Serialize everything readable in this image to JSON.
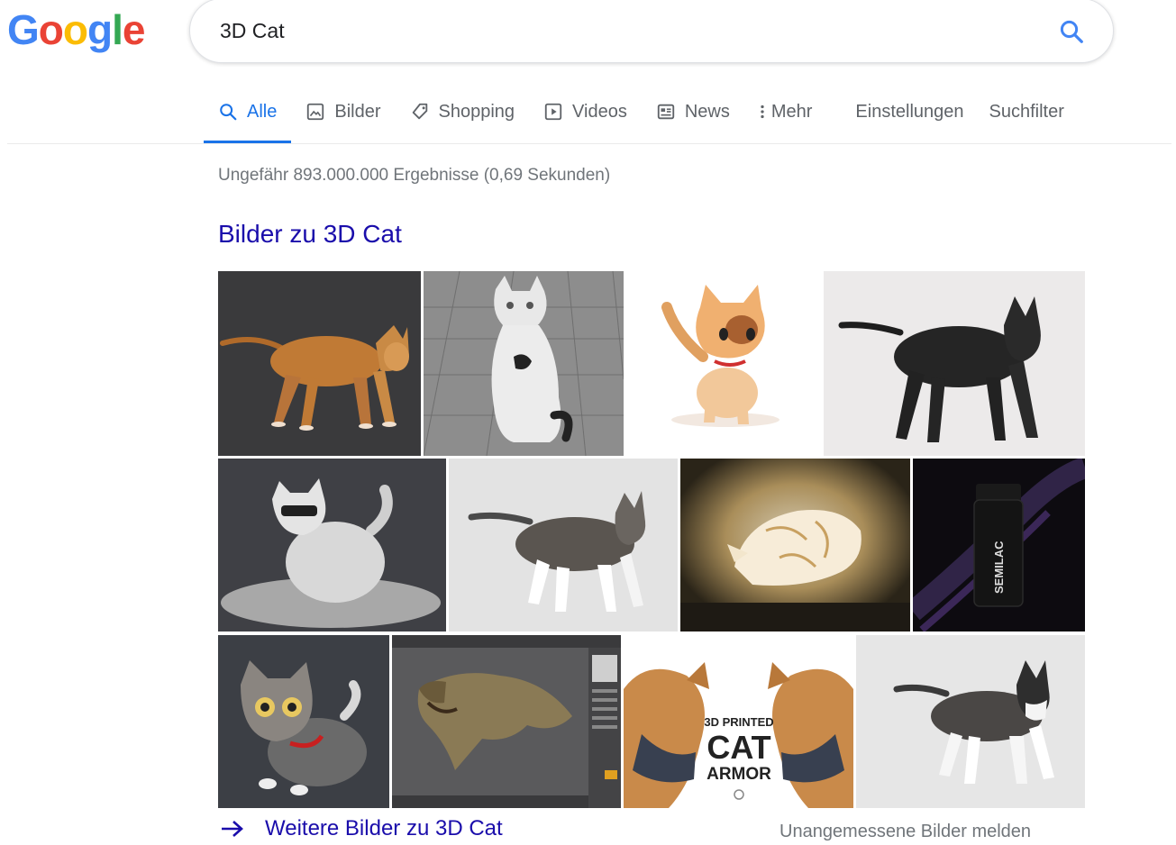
{
  "logo": {
    "letters": [
      "G",
      "o",
      "o",
      "g",
      "l",
      "e"
    ],
    "colors": [
      "#4285F4",
      "#EA4335",
      "#FBBC05",
      "#4285F4",
      "#34A853",
      "#EA4335"
    ]
  },
  "search": {
    "query": "3D Cat",
    "icon": "search-icon"
  },
  "tabs": [
    {
      "label": "Alle",
      "icon": "search-icon",
      "active": true
    },
    {
      "label": "Bilder",
      "icon": "image-icon"
    },
    {
      "label": "Shopping",
      "icon": "tag-icon"
    },
    {
      "label": "Videos",
      "icon": "play-icon"
    },
    {
      "label": "News",
      "icon": "newspaper-icon"
    },
    {
      "label": "Mehr",
      "icon": "more-vert-icon"
    },
    {
      "label": "Einstellungen"
    },
    {
      "label": "Suchfilter"
    }
  ],
  "result_stats": "Ungefähr 893.000.000 Ergebnisse (0,69 Sekunden)",
  "images_section": {
    "title": "Bilder zu 3D Cat",
    "more_link": "Weitere Bilder zu 3D Cat",
    "report_link": "Unangemessene Bilder melden",
    "images": [
      {
        "description": "orange-tabby-cat-3d",
        "semilac_label": ""
      },
      {
        "description": "white-cat-wireframe"
      },
      {
        "description": "cartoon-kitten"
      },
      {
        "description": "black-cat-3d"
      },
      {
        "description": "white-clay-cat"
      },
      {
        "description": "tabby-white-cat"
      },
      {
        "description": "glowing-cat-lamp"
      },
      {
        "description": "semilac-nail-polish",
        "label": "SEMILAC"
      },
      {
        "description": "cartoon-tabby-kitten"
      },
      {
        "description": "t-rex-render"
      },
      {
        "description": "3d-printed-cat-armor",
        "line1": "3D PRINTED",
        "line2": "CAT",
        "line3": "ARMOR"
      },
      {
        "description": "black-white-cat-3d"
      }
    ]
  },
  "colors": {
    "link": "#1a0dab",
    "accent": "#1a73e8",
    "muted": "#70757a"
  }
}
